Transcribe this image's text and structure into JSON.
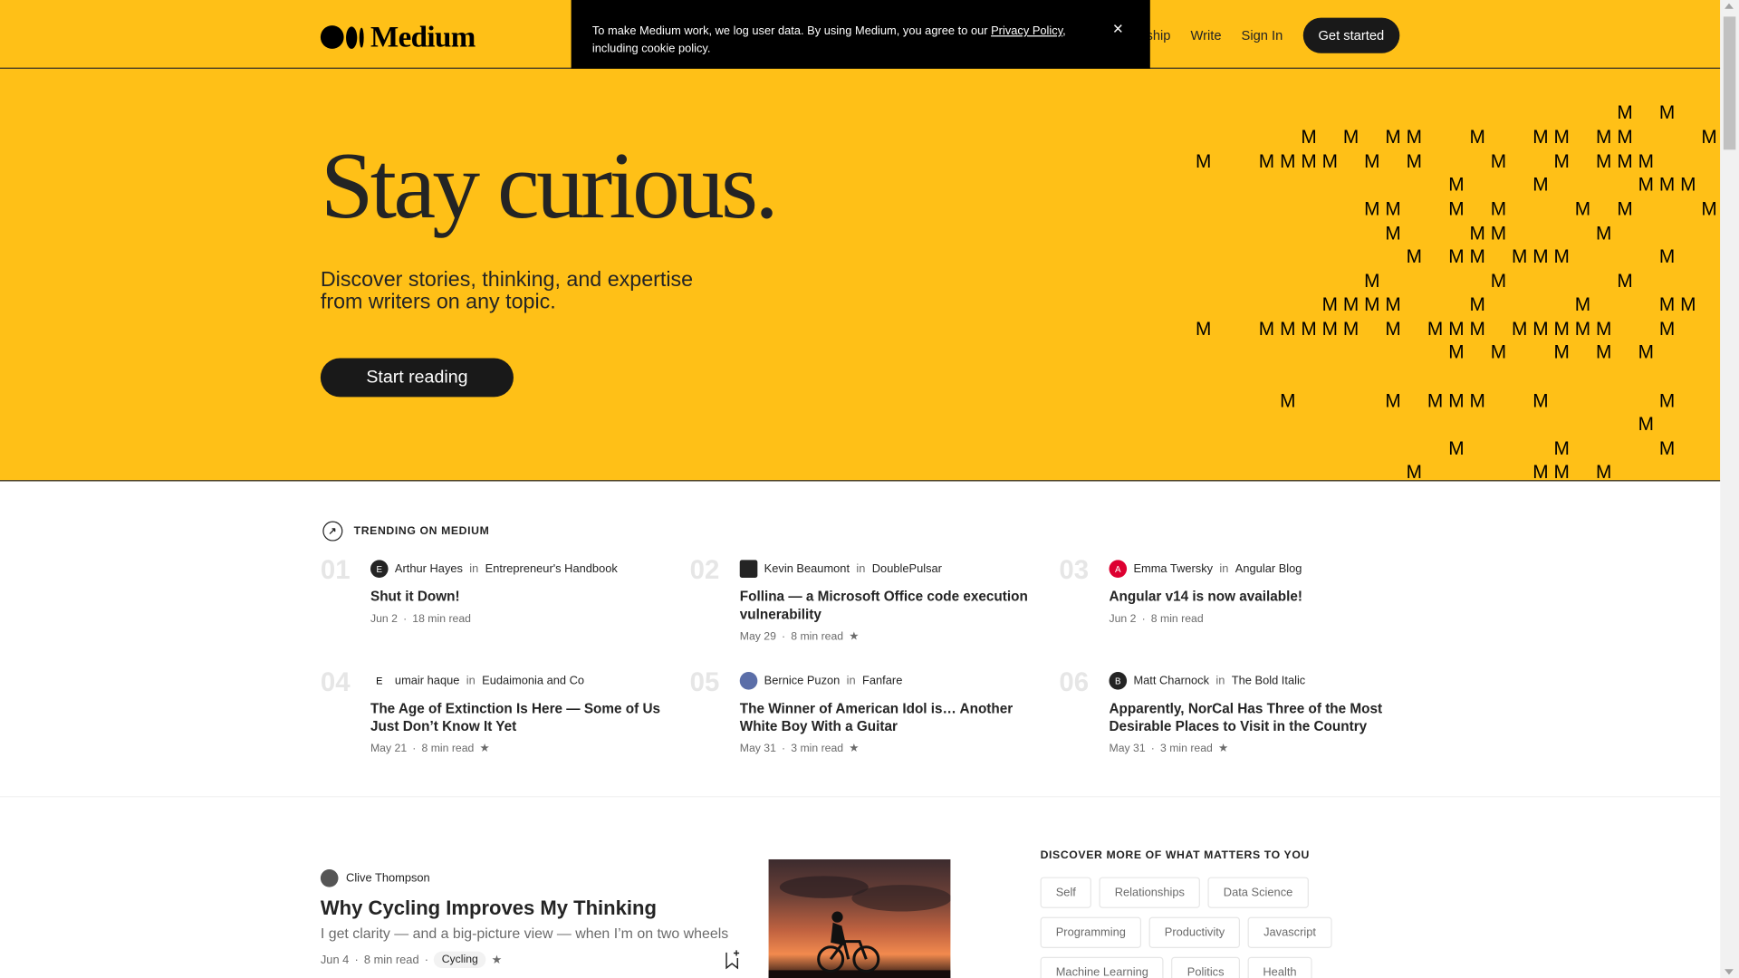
{
  "header": {
    "logo_text": "Medium",
    "nav": {
      "our_story_partial": "ship",
      "write": "Write",
      "sign_in": "Sign In",
      "get_started": "Get started"
    }
  },
  "cookie": {
    "text_before": "To make Medium work, we log user data. By using Medium, you agree to our ",
    "link": "Privacy Policy",
    "text_after": ", including cookie policy.",
    "close": "×"
  },
  "hero": {
    "title": "Stay curious.",
    "subtitle": "Discover stories, thinking, and expertise from writers on any topic.",
    "cta": "Start reading",
    "pattern_letter": "M"
  },
  "trending": {
    "heading": "TRENDING ON MEDIUM",
    "items": [
      {
        "num": "01",
        "author": "Arthur Hayes",
        "in": "in",
        "publication": "Entrepreneur's Handbook",
        "title": "Shut it Down!",
        "date": "Jun 2",
        "read": "18 min read",
        "star": ""
      },
      {
        "num": "02",
        "author": "Kevin Beaumont",
        "in": "in",
        "publication": "DoublePulsar",
        "title": "Follina — a Microsoft Office code execution vulnerability",
        "date": "May 29",
        "read": "8 min read",
        "star": "★"
      },
      {
        "num": "03",
        "author": "Emma Twersky",
        "in": "in",
        "publication": "Angular Blog",
        "title": "Angular v14 is now available!",
        "date": "Jun 2",
        "read": "8 min read",
        "star": ""
      },
      {
        "num": "04",
        "author": "umair haque",
        "in": "in",
        "publication": "Eudaimonia and Co",
        "title": "The Age of Extinction Is Here — Some of Us Just Don’t Know It Yet",
        "date": "May 21",
        "read": "8 min read",
        "star": "★"
      },
      {
        "num": "05",
        "author": "Bernice Puzon",
        "in": "in",
        "publication": "Fanfare",
        "title": "The Winner of American Idol is… Another White Boy With a Guitar",
        "date": "May 31",
        "read": "3 min read",
        "star": "★"
      },
      {
        "num": "06",
        "author": "Matt Charnock",
        "in": "in",
        "publication": "The Bold Italic",
        "title": "Apparently, NorCal Has Three of the Most Desirable Places to Visit in the Country",
        "date": "May 31",
        "read": "3 min read",
        "star": "★"
      }
    ]
  },
  "article": {
    "author": "Clive Thompson",
    "title": "Why Cycling Improves My Thinking",
    "subtitle": "I get clarity — and a big-picture view — when I’m on two wheels",
    "date": "Jun 4",
    "read": "8 min read",
    "tag": "Cycling",
    "star": "★"
  },
  "discover": {
    "title": "DISCOVER MORE OF WHAT MATTERS TO YOU",
    "topics": [
      "Self",
      "Relationships",
      "Data Science",
      "Programming",
      "Productivity",
      "Javascript",
      "Machine Learning",
      "Politics",
      "Health"
    ]
  },
  "colors": {
    "brand_yellow": "#ffc017",
    "dark": "#191919",
    "muted_text": "#6b6b6b"
  }
}
